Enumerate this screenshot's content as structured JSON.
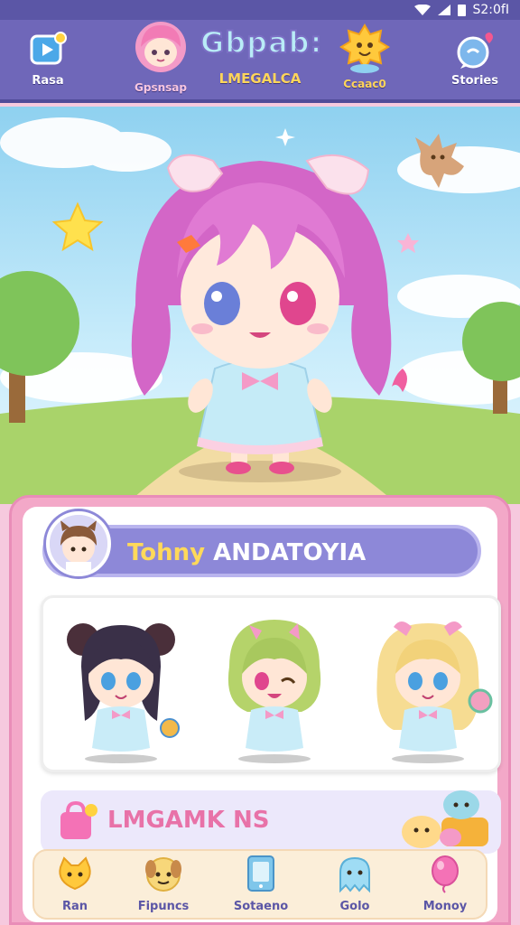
{
  "status_bar": {
    "time": "S2:0fI"
  },
  "top_nav": {
    "items": [
      {
        "label": "Rasa",
        "icon": "play-video-icon"
      },
      {
        "label": "Gpsnsap",
        "icon": "avatar-portrait-icon"
      },
      {
        "label": "LMEGALCA",
        "icon": "game-title-icon"
      },
      {
        "label": "Ccaac0",
        "icon": "sun-mascot-icon"
      },
      {
        "label": "Stories",
        "icon": "chat-heart-icon"
      }
    ],
    "title": "Gbpab:"
  },
  "scene": {
    "character": "pink-hair-chibi-girl"
  },
  "character_panel": {
    "name_prefix": "Tohny",
    "name_rest": " ANDATOYIA",
    "characters": [
      {
        "name": "dark-hair-chibi"
      },
      {
        "name": "green-hair-chibi"
      },
      {
        "name": "blonde-hair-chibi"
      }
    ]
  },
  "banner": {
    "label": "LMGAMK NS"
  },
  "bottom_nav": {
    "items": [
      {
        "label": "Ran",
        "icon": "cat-face-icon"
      },
      {
        "label": "Fipuncs",
        "icon": "puppy-icon"
      },
      {
        "label": "Sotaeno",
        "icon": "phone-card-icon"
      },
      {
        "label": "Golo",
        "icon": "ghost-icon"
      },
      {
        "label": "Monoy",
        "icon": "balloon-icon"
      }
    ]
  },
  "colors": {
    "nav_bg": "#6f67b9",
    "panel_pink": "#f3a8c8",
    "name_bar": "#8d88d8",
    "accent_yellow": "#ffd95a"
  }
}
